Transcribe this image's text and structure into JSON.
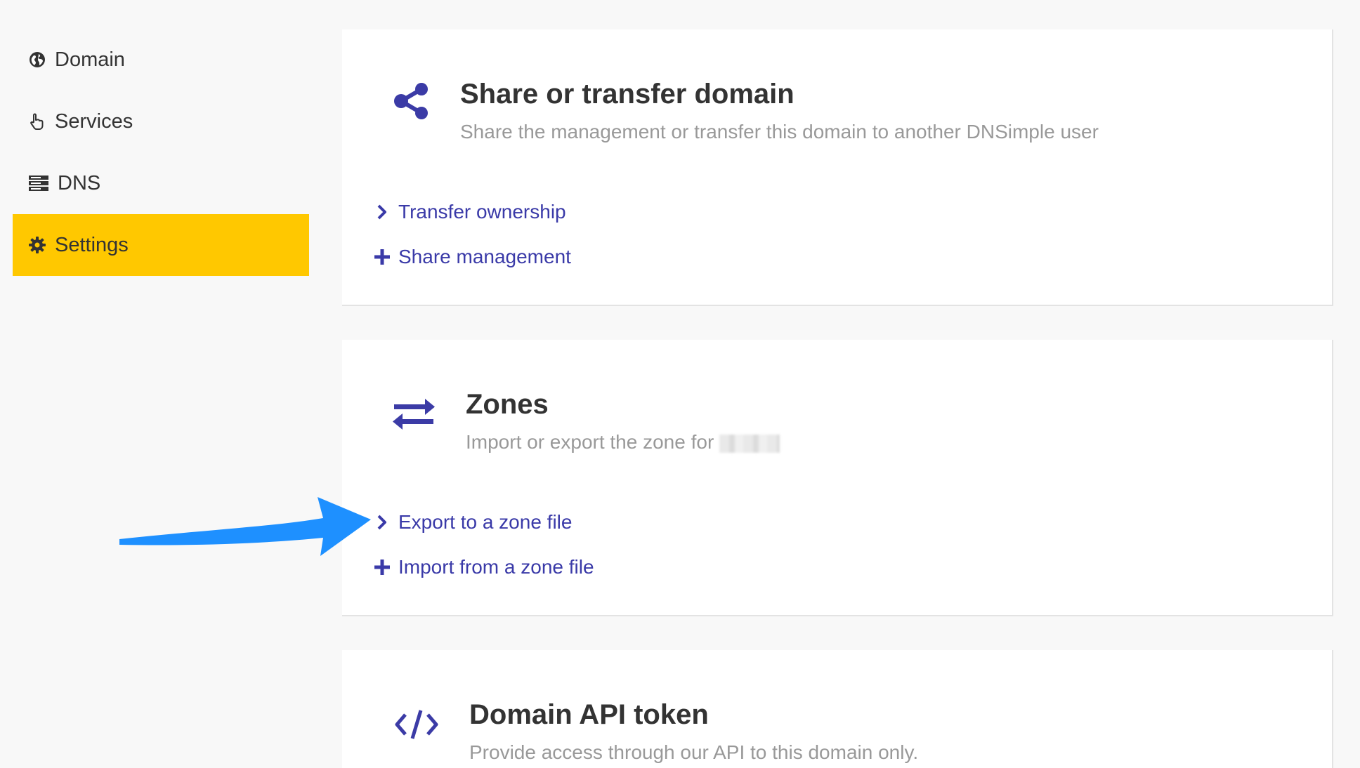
{
  "sidebar": {
    "items": [
      {
        "label": "Domain",
        "icon": "globe-icon"
      },
      {
        "label": "Services",
        "icon": "hand-pointer-icon"
      },
      {
        "label": "DNS",
        "icon": "server-icon"
      },
      {
        "label": "Settings",
        "icon": "gear-icon",
        "active": true
      }
    ],
    "active_color": "#ffc800"
  },
  "cards": {
    "share": {
      "icon": "share-icon",
      "title": "Share or transfer domain",
      "description": "Share the management or transfer this domain to another DNSimple user",
      "links": [
        {
          "label": "Transfer ownership",
          "icon": "chevron-right-icon"
        },
        {
          "label": "Share management",
          "icon": "plus-icon"
        }
      ]
    },
    "zones": {
      "icon": "exchange-arrows-icon",
      "title": "Zones",
      "description": "Import or export the zone for",
      "links": [
        {
          "label": "Export to a zone file",
          "icon": "chevron-right-icon"
        },
        {
          "label": "Import from a zone file",
          "icon": "plus-icon"
        }
      ]
    },
    "api": {
      "icon": "code-icon",
      "title": "Domain API token",
      "description": "Provide access through our API to this domain only."
    }
  },
  "colors": {
    "accent": "#3a3aa8",
    "icon": "#3b3ba6",
    "highlight": "#ffc800",
    "annotation_arrow": "#1e90ff"
  }
}
